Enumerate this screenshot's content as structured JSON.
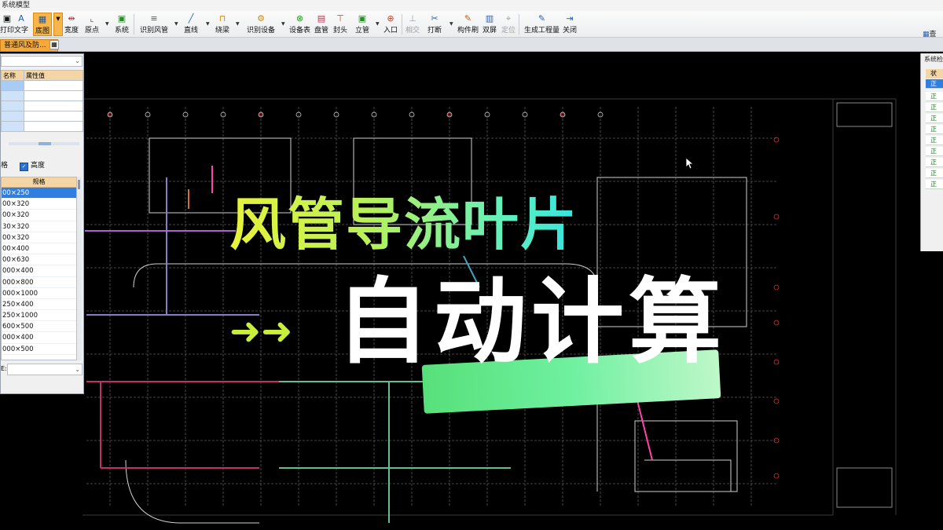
{
  "window": {
    "title": "系统模型"
  },
  "toolbar": {
    "items": [
      {
        "label": "打印",
        "icon": "print-icon"
      },
      {
        "label": "文字",
        "icon": "text-icon"
      },
      {
        "label": "底图",
        "icon": "base-map-icon"
      },
      {
        "label": "宽度",
        "icon": "width-icon"
      },
      {
        "label": "原点",
        "icon": "origin-icon"
      },
      {
        "label": "系统",
        "icon": "system-icon"
      },
      {
        "label": "识别风管",
        "icon": "identify-duct-icon"
      },
      {
        "label": "直线",
        "icon": "line-icon"
      },
      {
        "label": "绕梁",
        "icon": "around-beam-icon"
      },
      {
        "label": "识别设备",
        "icon": "identify-equipment-icon"
      },
      {
        "label": "设备表",
        "icon": "equipment-table-icon"
      },
      {
        "label": "盘管",
        "icon": "coil-icon"
      },
      {
        "label": "封头",
        "icon": "end-cap-icon"
      },
      {
        "label": "立管",
        "icon": "riser-icon"
      },
      {
        "label": "入口",
        "icon": "inlet-icon"
      },
      {
        "label": "相交",
        "icon": "intersect-icon"
      },
      {
        "label": "打断",
        "icon": "break-icon"
      },
      {
        "label": "构件刷",
        "icon": "component-brush-icon"
      },
      {
        "label": "双屏",
        "icon": "dual-screen-icon"
      },
      {
        "label": "定位",
        "icon": "locate-icon"
      },
      {
        "label": "生成工程量",
        "icon": "generate-quantity-icon"
      },
      {
        "label": "关闭",
        "icon": "close-icon"
      }
    ],
    "right_label": "查"
  },
  "tab": {
    "label": "普通风及防...",
    "close": "×"
  },
  "left_panel": {
    "prop_header": {
      "name": "名称",
      "value": "属性值"
    },
    "checkbox_left": "格",
    "checkbox_height": "高度",
    "spec_header": "规格",
    "specs": [
      "00×250",
      "00×320",
      "00×320",
      "30×320",
      "00×320",
      "00×400",
      "00×630",
      "000×400",
      "000×800",
      "000×1000",
      "250×400",
      "250×1000",
      "600×500",
      "000×400",
      "000×500"
    ],
    "bottom_label": "E:"
  },
  "right_panel": {
    "title": "系统检",
    "header": "状",
    "rows": [
      "正",
      "正",
      "正",
      "正",
      "正",
      "正",
      "正",
      "正",
      "正",
      "正"
    ]
  },
  "overlay": {
    "headline": "风管导流叶片",
    "arrows": "➜➜",
    "subline": "自动计算"
  },
  "colors": {
    "accent_orange": "#f6a93b",
    "headline_start": "#e8f33a",
    "headline_end": "#33e3e0",
    "highlight_green": "#57e07a",
    "selection_blue": "#2f7ee0"
  }
}
